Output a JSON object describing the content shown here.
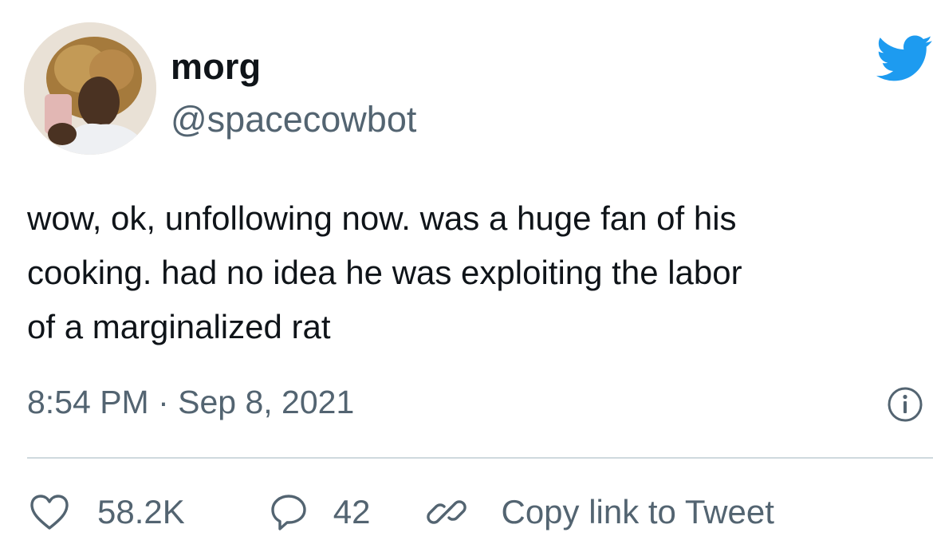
{
  "tweet": {
    "author": {
      "display_name": "morg",
      "handle": "@spacecowbot",
      "avatar_icon": "profile-photo"
    },
    "text": "wow, ok, unfollowing now. was a huge fan of his\ncooking. had no idea he was exploiting the labor\nof a marginalized rat",
    "timestamp": "8:54 PM · Sep 8, 2021",
    "actions": {
      "likes_count": "58.2K",
      "replies_count": "42",
      "copy_link_label": "Copy link to Tweet"
    }
  },
  "icons": {
    "brand": "twitter-bird-icon",
    "info": "info-icon",
    "like": "heart-icon",
    "reply": "speech-bubble-icon",
    "link": "link-icon"
  },
  "colors": {
    "brand_blue": "#1d9bf0",
    "text_primary": "#0f1419",
    "text_secondary": "#536471",
    "divider": "#cfd9de"
  }
}
